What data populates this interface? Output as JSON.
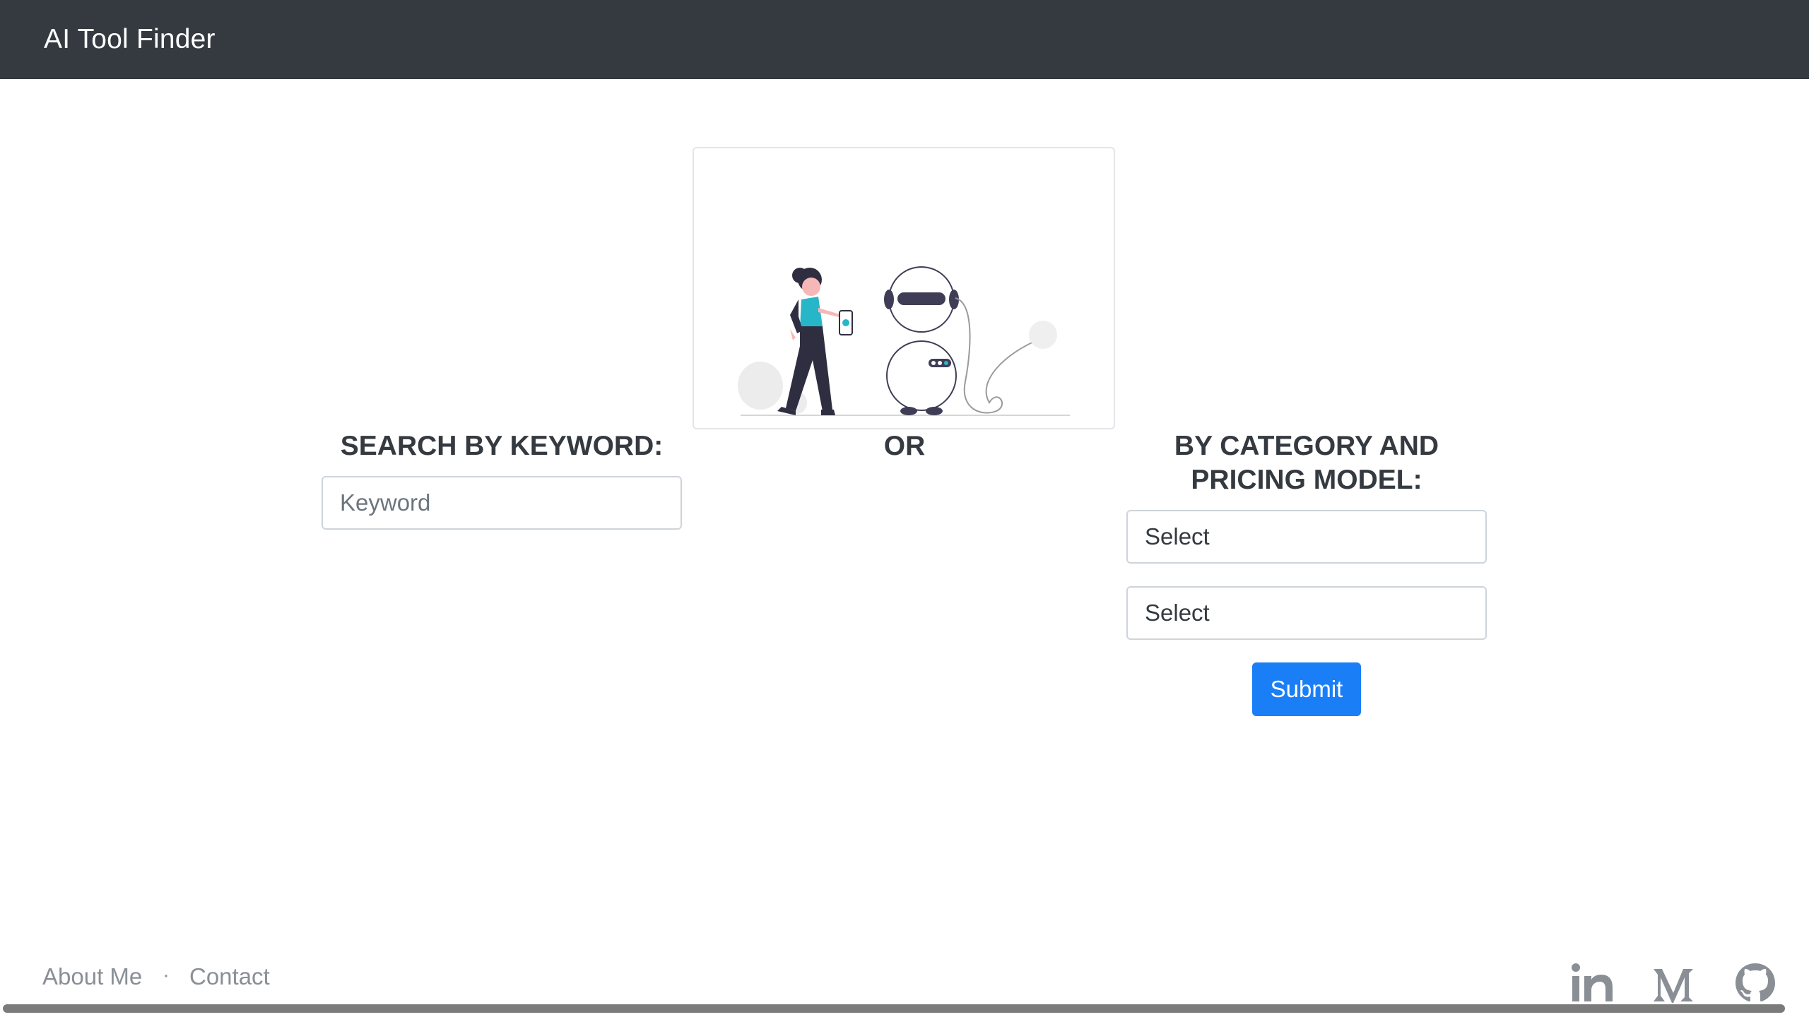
{
  "navbar": {
    "brand": "AI Tool Finder"
  },
  "keyword_section": {
    "heading": "SEARCH BY KEYWORD:",
    "input_placeholder": "Keyword",
    "input_value": ""
  },
  "divider_text": "OR",
  "category_section": {
    "heading_line1": "BY CATEGORY AND",
    "heading_line2": "PRICING MODEL:",
    "category_select": "Select",
    "pricing_select": "Select",
    "submit_label": "Submit"
  },
  "footer": {
    "about_label": "About Me",
    "separator": "·",
    "contact_label": "Contact",
    "social_icons": [
      "linkedin-icon",
      "medium-icon",
      "github-icon"
    ]
  },
  "colors": {
    "navbar_bg": "#343a40",
    "primary": "#1a7ef7",
    "illustration_accent": "#27b6c8",
    "illustration_dark": "#3f3d56"
  }
}
